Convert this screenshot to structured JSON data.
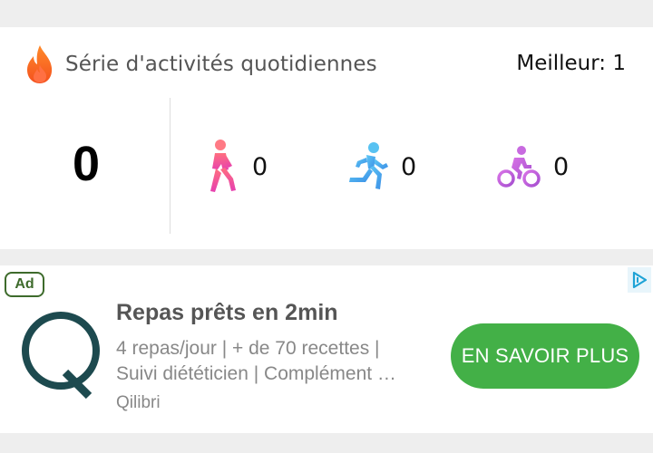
{
  "streak": {
    "title": "Série d'activités quotidiennes",
    "best_label": "Meilleur: 1",
    "current_count": "0",
    "activities": [
      {
        "icon": "walking-person-icon",
        "count": "0",
        "color": "#e8489a"
      },
      {
        "icon": "running-person-icon",
        "count": "0",
        "color": "#3ea9f0"
      },
      {
        "icon": "cycling-person-icon",
        "count": "0",
        "color": "#c25ad8"
      }
    ]
  },
  "ad": {
    "badge": "Ad",
    "headline": "Repas prêts en 2min",
    "description_line1": "4 repas/jour | + de 70 recettes |",
    "description_line2": "Suivi diététicien | Complément …",
    "brand": "Qilibri",
    "cta_label": "EN SAVOIR PLUS",
    "cta_color": "#43b047",
    "logo_icon": "qilibri-q-logo",
    "choices_icon": "adchoices-icon"
  }
}
